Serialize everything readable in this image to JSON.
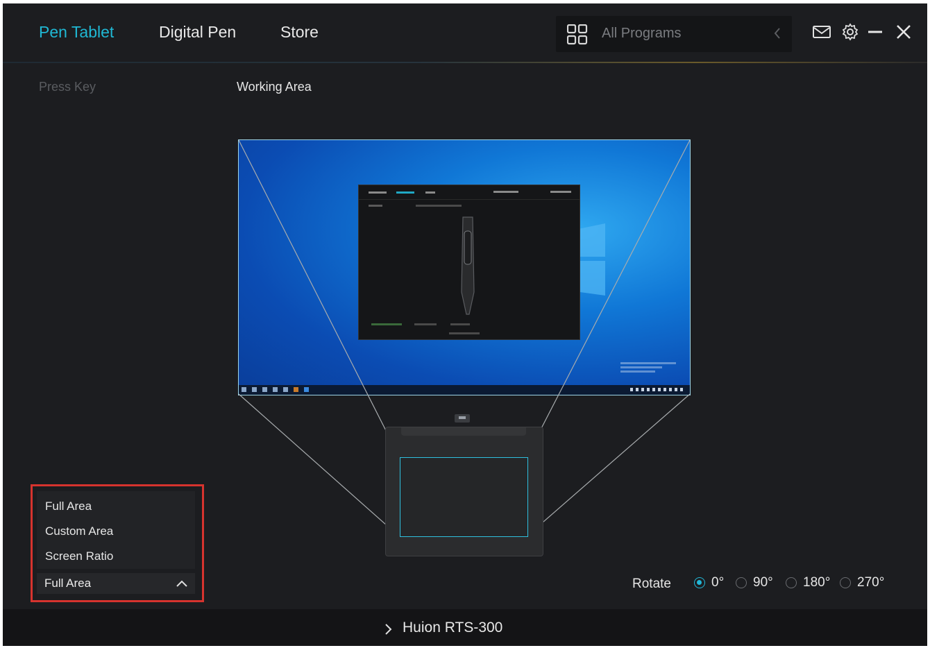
{
  "header": {
    "tabs": [
      {
        "label": "Pen Tablet",
        "active": true
      },
      {
        "label": "Digital Pen",
        "active": false
      },
      {
        "label": "Store",
        "active": false
      }
    ],
    "program_selector": {
      "label": "All Programs",
      "icon": "grid-icon"
    },
    "icons": [
      "chevron-left-icon",
      "mail-icon",
      "gear-icon",
      "minimize-icon",
      "close-icon"
    ],
    "accent_color": "#20b8d4"
  },
  "subtabs": [
    {
      "label": "Press Key",
      "active": false
    },
    {
      "label": "Working Area",
      "active": true
    }
  ],
  "area_dropdown": {
    "options": [
      "Full Area",
      "Custom Area",
      "Screen Ratio"
    ],
    "selected": "Full Area",
    "expanded": true,
    "highlight_color": "#d6332e"
  },
  "rotate": {
    "label": "Rotate",
    "options": [
      "0°",
      "90°",
      "180°",
      "270°"
    ],
    "selected": "0°"
  },
  "footer": {
    "device_name": "Huion RTS-300"
  }
}
